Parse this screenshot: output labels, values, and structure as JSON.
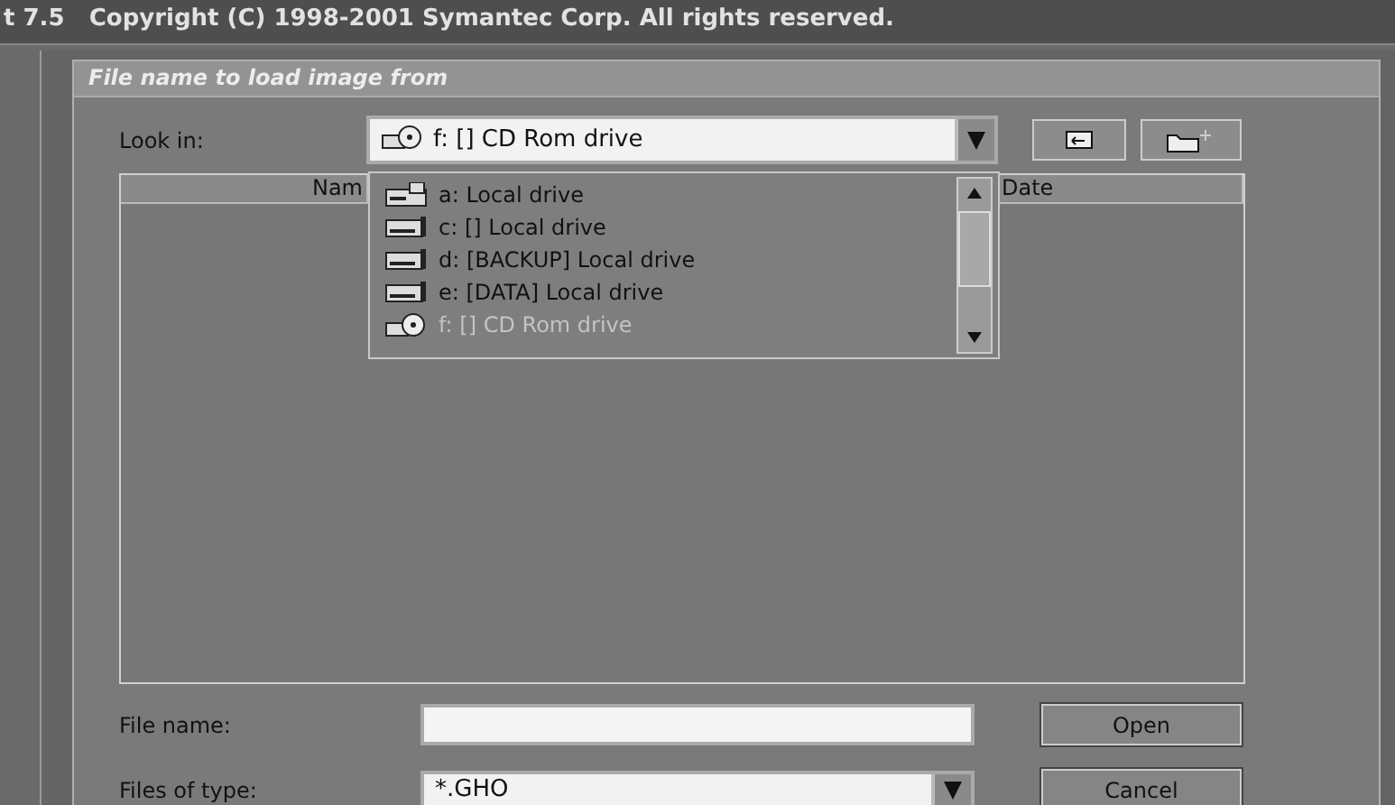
{
  "app_bar": {
    "title": "t 7.5   Copyright (C) 1998-2001 Symantec Corp. All rights reserved."
  },
  "dialog": {
    "title": "File name to load image from",
    "look_in": {
      "label": "Look in:",
      "value": "f: [] CD Rom drive",
      "expanded": true
    },
    "columns": [
      "Nam",
      "Date"
    ],
    "drives": [
      {
        "label": "a: Local drive",
        "kind": "floppy",
        "selected": false
      },
      {
        "label": "c: [] Local drive",
        "kind": "disk",
        "selected": false
      },
      {
        "label": "d: [BACKUP] Local drive",
        "kind": "disk",
        "selected": false
      },
      {
        "label": "e: [DATA] Local drive",
        "kind": "disk",
        "selected": false
      },
      {
        "label": "f: [] CD Rom drive",
        "kind": "cdrom",
        "selected": true
      }
    ],
    "file_name": {
      "label": "File name:"
    },
    "file_type": {
      "label": "Files of type:",
      "value": "*.GHO"
    },
    "buttons": [
      "Open",
      "Cancel"
    ]
  }
}
